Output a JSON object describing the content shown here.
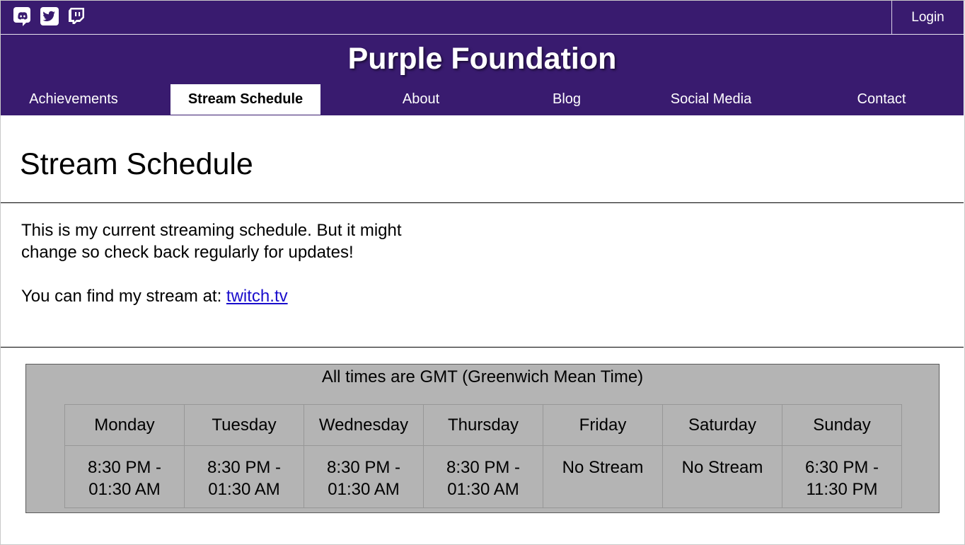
{
  "topbar": {
    "social_icons": [
      "discord-icon",
      "twitter-icon",
      "twitch-icon"
    ],
    "login_label": "Login"
  },
  "header": {
    "site_title": "Purple Foundation"
  },
  "nav": {
    "items": [
      {
        "label": "Achievements"
      },
      {
        "label": "Stream Schedule",
        "active": true
      },
      {
        "label": "About"
      },
      {
        "label": "Blog"
      },
      {
        "label": "Social Media"
      },
      {
        "label": "Contact"
      }
    ]
  },
  "main": {
    "heading": "Stream Schedule",
    "intro_text": "This is my current streaming schedule. But it might change so check back regularly for updates!",
    "find_text": "You can find my stream at: ",
    "stream_link": "twitch.tv"
  },
  "schedule": {
    "timezone_note": "All times are GMT (Greenwich Mean Time)",
    "days": [
      "Monday",
      "Tuesday",
      "Wednesday",
      "Thursday",
      "Friday",
      "Saturday",
      "Sunday"
    ],
    "times": [
      [
        "8:30 PM -",
        "01:30 AM"
      ],
      [
        "8:30 PM -",
        "01:30 AM"
      ],
      [
        "8:30 PM -",
        "01:30 AM"
      ],
      [
        "8:30 PM -",
        "01:30 AM"
      ],
      [
        "No Stream",
        ""
      ],
      [
        "No Stream",
        ""
      ],
      [
        "6:30 PM -",
        "11:30 PM"
      ]
    ]
  },
  "colors": {
    "brand_purple": "#391b6f",
    "table_background": "#b4b4b4",
    "link": "#1a0dcc"
  }
}
